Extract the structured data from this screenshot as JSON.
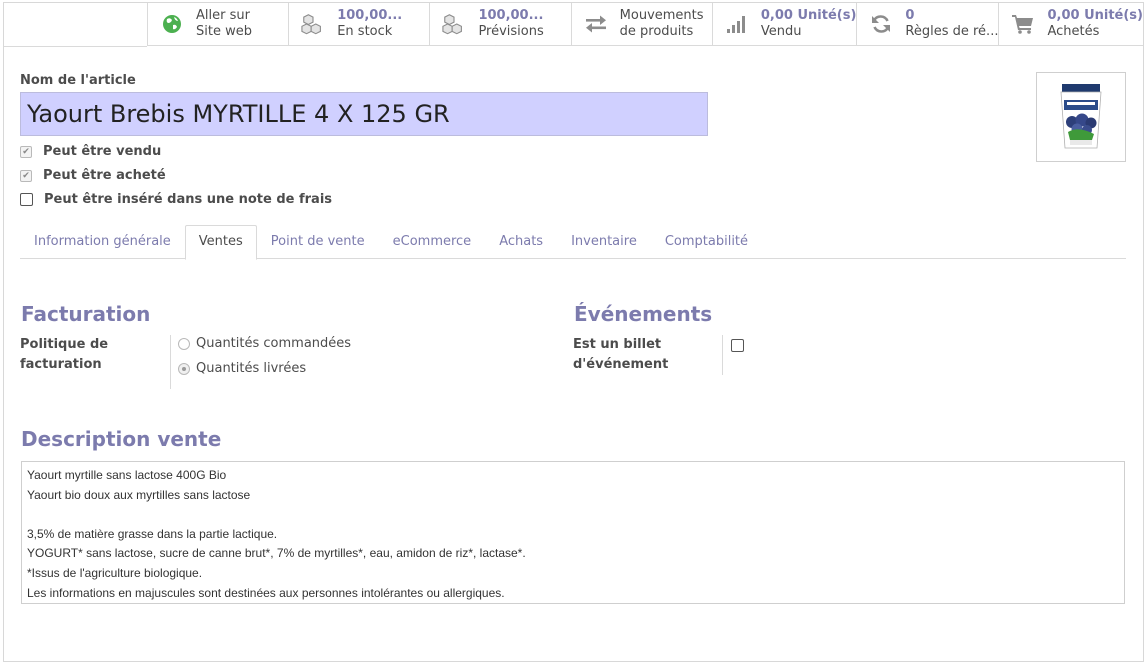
{
  "smart_buttons": [
    {
      "icon": "globe-icon",
      "value": "",
      "label_line1": "Aller sur",
      "label_line2": "Site web"
    },
    {
      "icon": "cubes-icon",
      "value": "100,00...",
      "label_line2": "En stock"
    },
    {
      "icon": "cubes-icon",
      "value": "100,00...",
      "label_line2": "Prévisions"
    },
    {
      "icon": "exchange-icon",
      "value": "",
      "label_line1": "Mouvements",
      "label_line2": "de produits"
    },
    {
      "icon": "signal-icon",
      "value": "0,00 Unité(s)",
      "label_line2": "Vendu"
    },
    {
      "icon": "refresh-icon",
      "value": "0",
      "label_line2": "Règles de ré..."
    },
    {
      "icon": "cart-icon",
      "value": "0,00 Unité(s)",
      "label_line2": "Achetés"
    }
  ],
  "product": {
    "name_label": "Nom de l'article",
    "name": "Yaourt Brebis MYRTILLE 4 X 125 GR",
    "image_alt": "product-image"
  },
  "checkboxes": [
    {
      "label": "Peut être vendu",
      "checked": true
    },
    {
      "label": "Peut être acheté",
      "checked": true
    },
    {
      "label": "Peut être inséré dans une note de frais",
      "checked": false
    }
  ],
  "tabs": [
    {
      "label": "Information générale",
      "active": false
    },
    {
      "label": "Ventes",
      "active": true
    },
    {
      "label": "Point de vente",
      "active": false
    },
    {
      "label": "eCommerce",
      "active": false
    },
    {
      "label": "Achats",
      "active": false
    },
    {
      "label": "Inventaire",
      "active": false
    },
    {
      "label": "Comptabilité",
      "active": false
    }
  ],
  "facturation": {
    "title": "Facturation",
    "field_label_line1": "Politique de",
    "field_label_line2": "facturation",
    "options": [
      {
        "label": "Quantités commandées",
        "checked": false
      },
      {
        "label": "Quantités livrées",
        "checked": true
      }
    ]
  },
  "evenements": {
    "title": "Événements",
    "field_label_line1": "Est un billet",
    "field_label_line2": "d'événement",
    "checked": false
  },
  "description": {
    "title": "Description vente",
    "lines": [
      "Yaourt myrtille sans lactose 400G Bio",
      "Yaourt bio doux aux myrtilles sans lactose",
      "",
      "3,5% de matière grasse dans la partie lactique.",
      "YOGURT* sans lactose, sucre de canne brut*, 7% de myrtilles*, eau, amidon de riz*, lactase*.",
      "*Issus de l'agriculture biologique.",
      "Les informations en majuscules sont destinées aux personnes intolérantes ou allergiques."
    ]
  },
  "colors": {
    "accent": "#7c7bad",
    "name_input_bg": "#d0d0ff",
    "globe_green": "#4cb050"
  }
}
